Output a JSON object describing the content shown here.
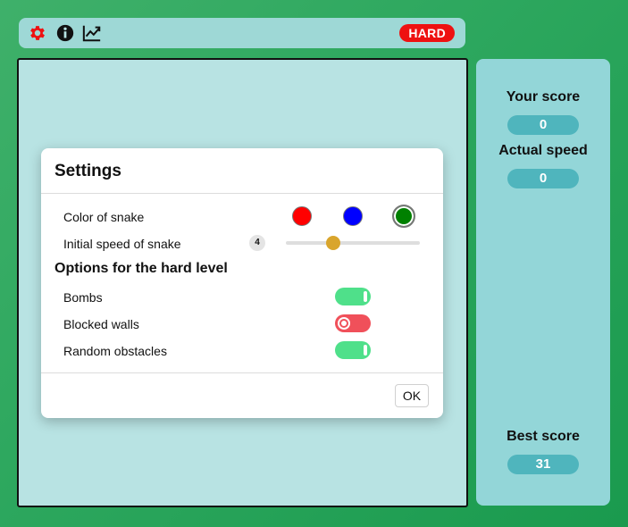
{
  "topbar": {
    "icons": [
      "gear-icon",
      "info-icon",
      "chart-icon"
    ],
    "difficulty_badge": "HARD",
    "colors": {
      "gear": "#ee1111",
      "badge": "#ee1111"
    }
  },
  "sidebar": {
    "your_score_label": "Your score",
    "your_score_value": "0",
    "actual_speed_label": "Actual speed",
    "actual_speed_value": "0",
    "best_score_label": "Best score",
    "best_score_value": "31"
  },
  "settings": {
    "title": "Settings",
    "color_label": "Color of snake",
    "colors": [
      {
        "name": "red",
        "hex": "#ff0000",
        "selected": false
      },
      {
        "name": "blue",
        "hex": "#0000ff",
        "selected": false
      },
      {
        "name": "green",
        "hex": "#008000",
        "selected": true
      }
    ],
    "speed_label": "Initial speed of snake",
    "speed_value": "4",
    "speed_slider_fraction": 0.35,
    "hard_options_title": "Options for the hard level",
    "options": [
      {
        "label": "Bombs",
        "enabled": true
      },
      {
        "label": "Blocked walls",
        "enabled": false
      },
      {
        "label": "Random obstacles",
        "enabled": true
      }
    ],
    "ok_label": "OK"
  }
}
